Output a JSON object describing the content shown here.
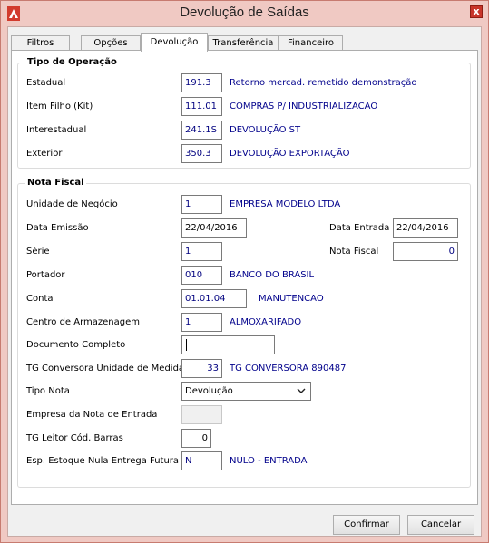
{
  "window": {
    "title": "Devolução de Saídas",
    "close_label": "x"
  },
  "tabs": [
    {
      "label": "Filtros"
    },
    {
      "label": "Opções"
    },
    {
      "label": "Devolução"
    },
    {
      "label": "Transferência"
    },
    {
      "label": "Financeiro"
    }
  ],
  "active_tab": "Devolução",
  "tipo_operacao": {
    "title": "Tipo de Operação",
    "rows": [
      {
        "label": "Estadual",
        "code": "191.3",
        "desc": "Retorno mercad. remetido demonstração"
      },
      {
        "label": "Item Filho (Kit)",
        "code": "111.01",
        "desc": "COMPRAS P/ INDUSTRIALIZACAO"
      },
      {
        "label": "Interestadual",
        "code": "241.1S",
        "desc": "DEVOLUÇÃO ST"
      },
      {
        "label": "Exterior",
        "code": "350.3",
        "desc": "DEVOLUÇÃO EXPORTAÇÃO"
      }
    ]
  },
  "nota_fiscal": {
    "title": "Nota Fiscal",
    "unidade": {
      "label": "Unidade de Negócio",
      "value": "1",
      "desc": "EMPRESA MODELO LTDA"
    },
    "data_emissao": {
      "label": "Data Emissão",
      "value": "22/04/2016"
    },
    "data_entrada": {
      "label": "Data Entrada",
      "value": "22/04/2016"
    },
    "serie": {
      "label": "Série",
      "value": "1"
    },
    "nota": {
      "label": "Nota Fiscal",
      "value": "0"
    },
    "portador": {
      "label": "Portador",
      "value": "010",
      "desc": "BANCO DO BRASIL"
    },
    "conta": {
      "label": "Conta",
      "value": "01.01.04",
      "desc": "MANUTENCAO"
    },
    "centro": {
      "label": "Centro de Armazenagem",
      "value": "1",
      "desc": "ALMOXARIFADO"
    },
    "documento": {
      "label": "Documento Completo",
      "value": ""
    },
    "conversora": {
      "label": "TG Conversora Unidade de Medida",
      "value": "33",
      "desc": "TG CONVERSORA 890487"
    },
    "tipo_nota": {
      "label": "Tipo Nota",
      "value": "Devolução"
    },
    "empresa_entrada": {
      "label": "Empresa da Nota de Entrada",
      "value": ""
    },
    "leitor": {
      "label": "TG Leitor Cód. Barras",
      "value": "0"
    },
    "esp_estoque": {
      "label": "Esp. Estoque Nula Entrega Futura",
      "value": "N",
      "desc": "NULO - ENTRADA"
    }
  },
  "buttons": {
    "confirm": "Confirmar",
    "cancel": "Cancelar"
  },
  "colors": {
    "frame": "#f0c9c3",
    "close": "#c8352a",
    "value_text": "#00007f"
  }
}
